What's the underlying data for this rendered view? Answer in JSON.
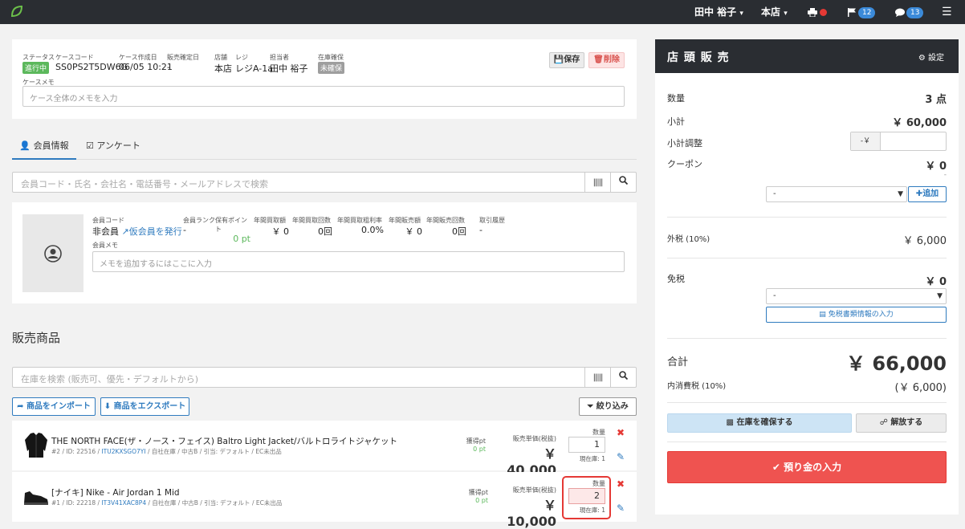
{
  "topbar": {
    "user": "田中 裕子",
    "store": "本店",
    "flag_count": "12",
    "chat_count": "13"
  },
  "case": {
    "status_label": "ステータス",
    "status_value": "進行中",
    "code_label": "ケースコード",
    "code_value": "SS0PS2T5DW6G",
    "created_label": "ケース作成日",
    "created_value": "06/05 10:21",
    "confirmed_label": "販売確定日",
    "confirmed_value": "-",
    "store_label": "店舗",
    "store_value": "本店",
    "register_label": "レジ",
    "register_value": "レジA-1a",
    "staff_label": "担当者",
    "staff_value": "田中 裕子",
    "stock_label": "在庫確保",
    "stock_value": "未確保",
    "save_label": "保存",
    "delete_label": "削除",
    "memo_label": "ケースメモ",
    "memo_placeholder": "ケース全体のメモを入力"
  },
  "tabs": {
    "member": "会員情報",
    "survey": "アンケート"
  },
  "member_search": {
    "placeholder": "会員コード・氏名・会社名・電話番号・メールアドレスで検索"
  },
  "member": {
    "code_label": "会員コード",
    "code_value": "非会員",
    "temp_link": "仮会員を発行",
    "rank_label": "会員ランク",
    "rank_value": "-",
    "points_label": "保有ポイント",
    "points_value": "0 pt",
    "annual_buy_label": "年間買取額",
    "annual_buy_value": "￥ 0",
    "annual_buy_count_label": "年間買取回数",
    "annual_buy_count_value": "0回",
    "annual_margin_label": "年間買取粗利率",
    "annual_margin_value": "0.0%",
    "annual_sales_label": "年間販売額",
    "annual_sales_value": "￥ 0",
    "annual_sales_count_label": "年間販売回数",
    "annual_sales_count_value": "0回",
    "history_label": "取引履歴",
    "history_value": "-",
    "memo_label": "会員メモ",
    "memo_placeholder": "メモを追加するにはここに入力"
  },
  "products": {
    "section_title": "販売商品",
    "search_placeholder": "在庫を検索 (販売可、優先・デフォルトから)",
    "import_label": "商品をインポート",
    "export_label": "商品をエクスポート",
    "filter_label": "絞り込み",
    "items": [
      {
        "name": "THE NORTH FACE(ザ・ノース・フェイス) Baltro Light Jacket/バルトロライトジャケット",
        "meta_prefix": "#2 / ID: 22516 /",
        "sku": "ITU2KXSGO7YI",
        "meta_suffix": "/ 自社在庫 / 中古B / 引当: デフォルト / EC未出品",
        "points_label": "獲得pt",
        "points_value": "0 pt",
        "price_label": "販売単価(税抜)",
        "price_value": "￥ 40,000",
        "qty_label": "数量",
        "qty_value": "1",
        "stock_text": "現在庫: 1"
      },
      {
        "name": "[ナイキ] Nike - Air Jordan 1 Mid",
        "meta_prefix": "#1 / ID: 22218 /",
        "sku": "IT3V41XAC8P4",
        "meta_suffix": "/ 自社在庫 / 中古B / 引当: デフォルト / EC未出品",
        "points_label": "獲得pt",
        "points_value": "0 pt",
        "price_label": "販売単価(税抜)",
        "price_value": "￥ 10,000",
        "qty_label": "数量",
        "qty_value": "2",
        "stock_text": "現在庫: 1"
      }
    ]
  },
  "panel": {
    "title": "店 頭 販 売",
    "settings_label": "設定",
    "qty_label": "数量",
    "qty_value": "3 点",
    "subtotal_label": "小計",
    "subtotal_value": "￥ 60,000",
    "adjust_label": "小計調整",
    "adjust_prefix": "-￥",
    "coupon_label": "クーポン",
    "coupon_value": "￥ 0",
    "coupon_dash": "-",
    "coupon_select": "-",
    "add_label": "追加",
    "ext_tax_label": "外税 (10%)",
    "ext_tax_value": "￥ 6,000",
    "exempt_label": "免税",
    "exempt_value": "￥ 0",
    "exempt_select": "-",
    "exempt_doc_label": "免税書類情報の入力",
    "total_label": "合計",
    "total_value": "￥ 66,000",
    "int_tax_label": "内消費税 (10%)",
    "int_tax_value": "(￥ 6,000)",
    "reserve_label": "在庫を確保する",
    "release_label": "解放する",
    "deposit_label": "預り金の入力"
  },
  "colors": {
    "topbar": "#2a2d32",
    "accent_blue": "#2f7bbf",
    "green": "#5cb85c",
    "danger": "#ef5350"
  }
}
